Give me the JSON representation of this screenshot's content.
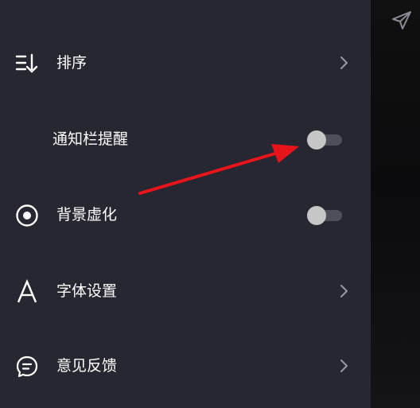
{
  "menu": {
    "sort": {
      "label": "排序",
      "icon": "sort-descending-icon",
      "action": "chevron-right-icon"
    },
    "notification_reminder": {
      "label": "通知栏提醒",
      "toggle_on": false
    },
    "background_blur": {
      "label": "背景虚化",
      "icon": "radio-target-icon",
      "toggle_on": false
    },
    "font_settings": {
      "label": "字体设置",
      "icon": "font-letter-a-icon",
      "action": "chevron-right-icon"
    },
    "feedback": {
      "label": "意见反馈",
      "icon": "chat-bubble-icon",
      "action": "chevron-right-icon"
    }
  },
  "header": {
    "icon": "send-paper-plane-icon"
  },
  "annotation": {
    "icon": "red-arrow-annotation",
    "color": "#e8141b"
  },
  "colors": {
    "drawer_bg": "#272731",
    "text": "#ffffff",
    "toggle_knob": "#c6c6c6",
    "toggle_track": "#4f4f5a"
  }
}
